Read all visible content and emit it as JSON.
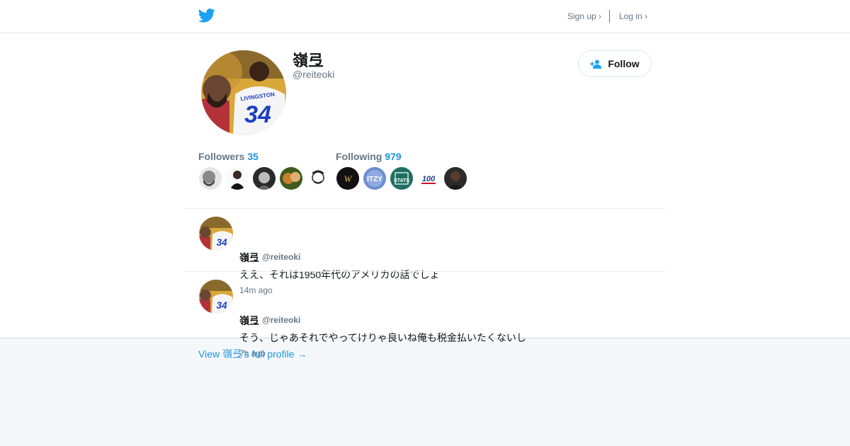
{
  "header": {
    "logo_icon": "twitter-bird-icon",
    "signup_label": "Sign up ›",
    "login_label": "Log in ›"
  },
  "profile": {
    "display_name": "嶺弖",
    "handle": "@reiteoki",
    "follow_label": "Follow",
    "avatar_jersey_number": "34",
    "avatar_jersey_text": "LIVINGSTON"
  },
  "stats": {
    "followers_label": "Followers",
    "followers_count": "35",
    "following_label": "Following",
    "following_count": "979"
  },
  "tweets": [
    {
      "name": "嶺弖",
      "handle": "@reiteoki",
      "text": "ええ、それは1950年代のアメリカの話でしょ",
      "time": "14m ago"
    },
    {
      "name": "嶺弖",
      "handle": "@reiteoki",
      "text": "そう、じゃあそれでやってけりゃ良いね俺も税金払いたくないし",
      "time": "7h ago"
    }
  ],
  "footer": {
    "full_profile_link": "View 嶺弖's full profile →"
  },
  "colors": {
    "brand": "#1da1f2",
    "link": "#1b95e0",
    "muted": "#657786"
  }
}
